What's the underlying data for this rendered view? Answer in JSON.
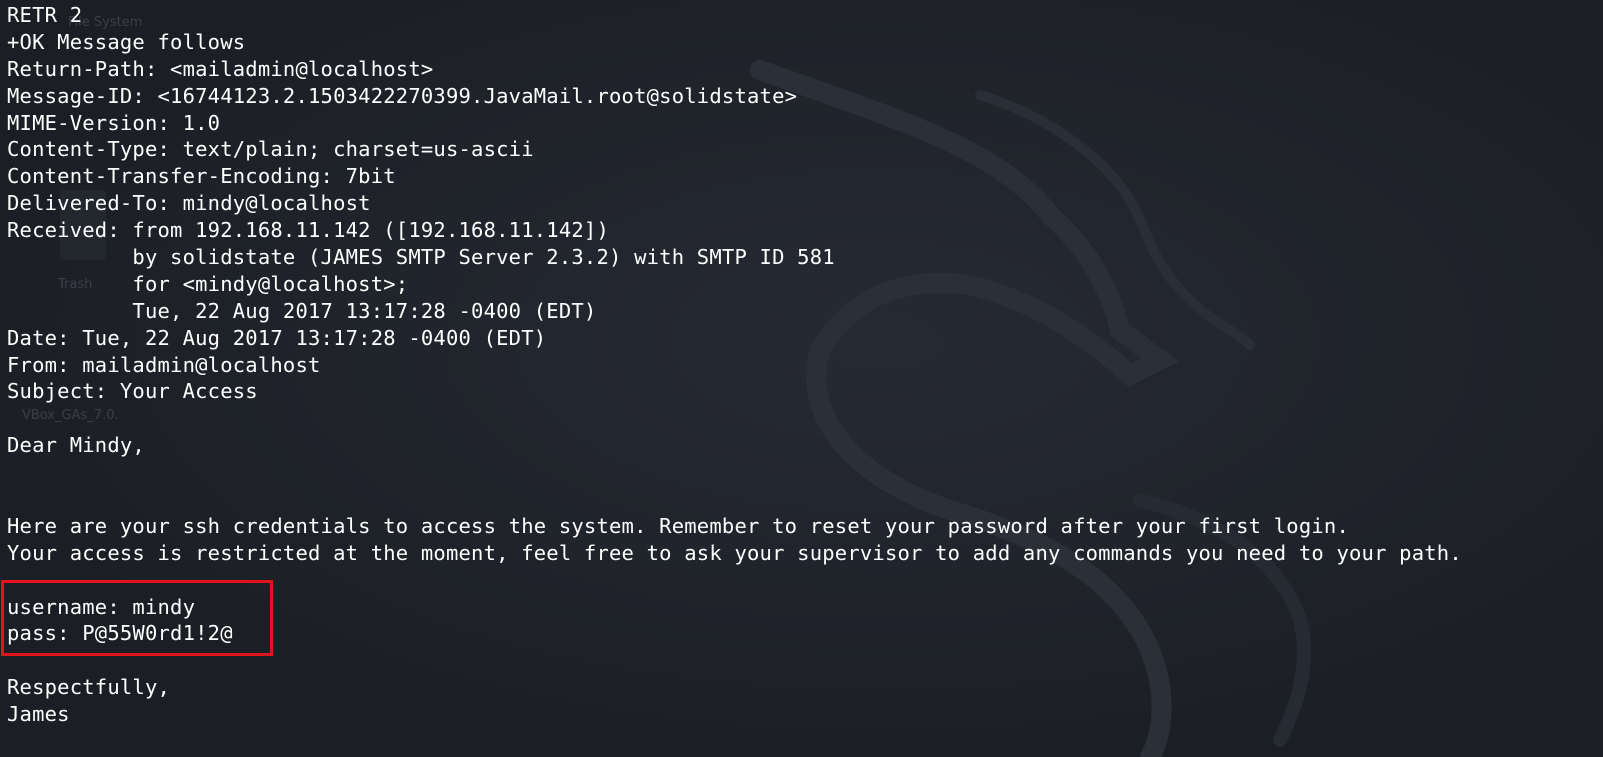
{
  "desktop": {
    "labels": {
      "system": "File System",
      "trash": "Trash",
      "vbox": "VBox_GAs_7.0."
    }
  },
  "terminal": {
    "lines": [
      "RETR 2",
      "+OK Message follows",
      "Return-Path: <mailadmin@localhost>",
      "Message-ID: <16744123.2.1503422270399.JavaMail.root@solidstate>",
      "MIME-Version: 1.0",
      "Content-Type: text/plain; charset=us-ascii",
      "Content-Transfer-Encoding: 7bit",
      "Delivered-To: mindy@localhost",
      "Received: from 192.168.11.142 ([192.168.11.142])",
      "          by solidstate (JAMES SMTP Server 2.3.2) with SMTP ID 581",
      "          for <mindy@localhost>;",
      "          Tue, 22 Aug 2017 13:17:28 -0400 (EDT)",
      "Date: Tue, 22 Aug 2017 13:17:28 -0400 (EDT)",
      "From: mailadmin@localhost",
      "Subject: Your Access",
      "",
      "Dear Mindy,",
      "",
      "",
      "Here are your ssh credentials to access the system. Remember to reset your password after your first login.",
      "Your access is restricted at the moment, feel free to ask your supervisor to add any commands you need to your path.",
      "",
      "username: mindy",
      "pass: P@55W0rd1!2@",
      "",
      "Respectfully,",
      "James"
    ]
  },
  "colors": {
    "background": "#1e2128",
    "text": "#ffffff",
    "highlight": "#e0141a"
  }
}
